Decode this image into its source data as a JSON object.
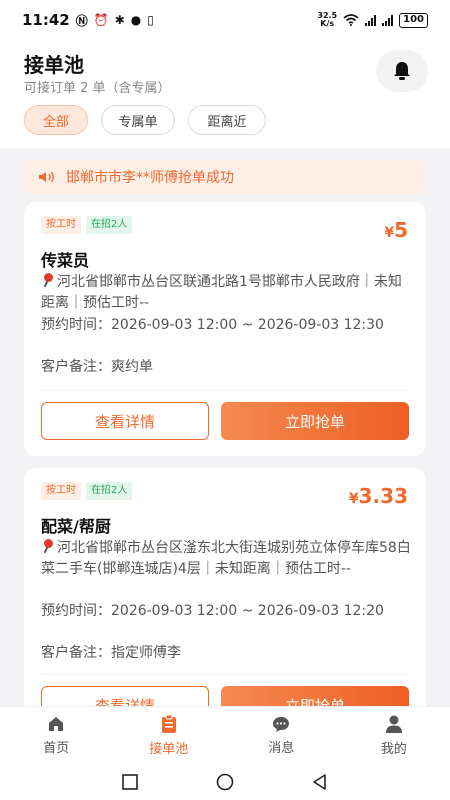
{
  "status_bar": {
    "time": "11:42",
    "net_speed_value": "32.5",
    "net_speed_unit": "K/s",
    "battery": "100"
  },
  "header": {
    "title": "接单池",
    "subtitle": "可接订单 2 单（含专属）",
    "bell_icon": "bell-icon"
  },
  "filters": [
    {
      "label": "全部",
      "active": true
    },
    {
      "label": "专属单",
      "active": false
    },
    {
      "label": "距离近",
      "active": false
    }
  ],
  "notice": {
    "text": "邯郸市市李**师傅抢单成功",
    "icon": "speaker-icon"
  },
  "orders": [
    {
      "tag_type": "按工时",
      "tag_hiring": "在招2人",
      "currency": "¥",
      "price": "5",
      "title": "传菜员",
      "address": "河北省邯郸市丛台区联通北路1号邯郸市人民政府｜未知距离｜预估工时--",
      "appointment": "预约时间：2026-09-03 12:00 ~ 2026-09-03 12:30",
      "remark": "客户备注：爽约单",
      "detail_label": "查看详情",
      "grab_label": "立即抢单"
    },
    {
      "tag_type": "按工时",
      "tag_hiring": "在招2人",
      "currency": "¥",
      "price": "3.33",
      "title": "配菜/帮厨",
      "address": "河北省邯郸市丛台区滏东北大街连城别苑立体停车库58白菜二手车(邯郸连城店)4层｜未知距离｜预估工时--",
      "appointment": "预约时间：2026-09-03 12:00 ~ 2026-09-03 12:20",
      "remark": "客户备注：指定师傅李",
      "detail_label": "查看详情",
      "grab_label": "立即抢单"
    }
  ],
  "bottom_nav": [
    {
      "label": "首页",
      "icon": "home-icon",
      "active": false
    },
    {
      "label": "接单池",
      "icon": "clipboard-icon",
      "active": true
    },
    {
      "label": "消息",
      "icon": "chat-icon",
      "active": false
    },
    {
      "label": "我的",
      "icon": "user-icon",
      "active": false
    }
  ],
  "colors": {
    "accent": "#ef6a2c",
    "accent_light": "#fde8dc",
    "hiring_green": "#26a65b",
    "background": "#f3f3f5"
  }
}
